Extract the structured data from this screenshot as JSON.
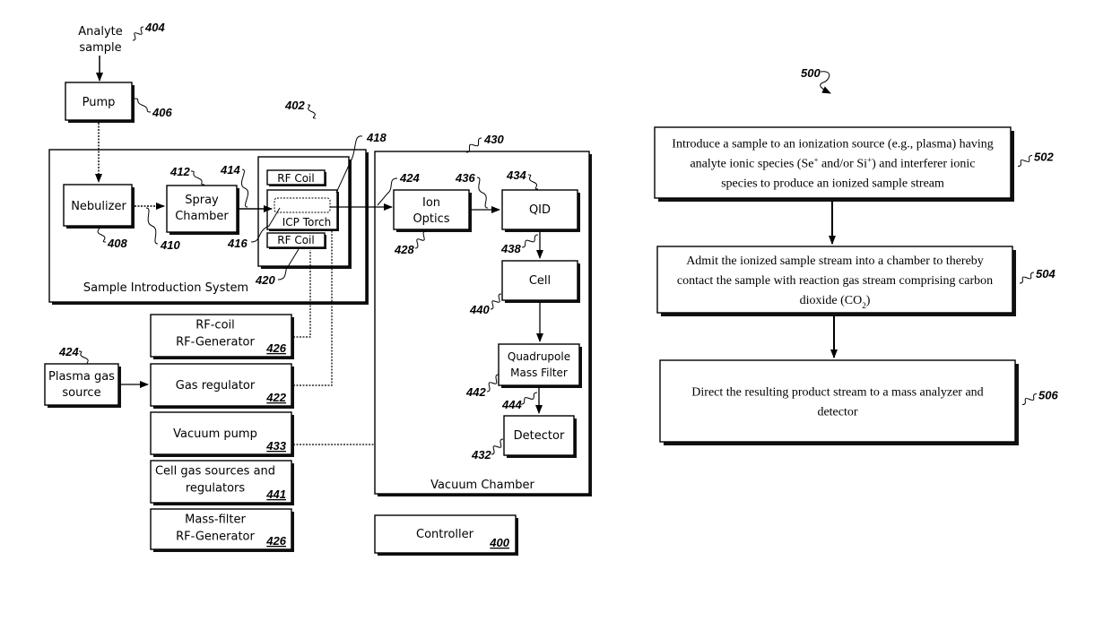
{
  "figure_left": {
    "ref": "402",
    "analyte_sample": {
      "lines": [
        "Analyte",
        "sample"
      ],
      "ref": "404"
    },
    "pump": {
      "label": "Pump",
      "ref": "406"
    },
    "sample_introduction_system": {
      "label": "Sample Introduction System",
      "nebulizer": {
        "label": "Nebulizer",
        "ref": "408"
      },
      "nebulizer_link_ref": "410",
      "spray_chamber": {
        "lines": [
          "Spray",
          "Chamber"
        ],
        "ref": "412"
      },
      "spray_link_ref": "414",
      "torch_assembly_ref": "418",
      "rf_coil_top": {
        "label": "RF Coil"
      },
      "icp_torch": {
        "label": "ICP Torch",
        "inner_ref": "416"
      },
      "rf_coil_bottom": {
        "label": "RF Coil",
        "ref": "420"
      }
    },
    "vacuum_chamber": {
      "label": "Vacuum Chamber",
      "ref": "430",
      "inlet_ref": "424",
      "ion_optics": {
        "lines": [
          "Ion",
          "Optics"
        ],
        "ref": "428"
      },
      "ion_link_ref": "436",
      "qid": {
        "label": "QID",
        "ref": "434"
      },
      "qid_link_ref": "438",
      "cell": {
        "label": "Cell",
        "ref": "440"
      },
      "quadrupole": {
        "lines": [
          "Quadrupole",
          "Mass Filter"
        ],
        "ref": "442"
      },
      "quad_link_ref": "444",
      "detector": {
        "label": "Detector",
        "ref": "432"
      }
    },
    "plasma_gas_source": {
      "lines": [
        "Plasma gas",
        "source"
      ],
      "ref": "424"
    },
    "support_units": [
      {
        "lines": [
          "RF-coil",
          "RF-Generator"
        ],
        "ref": "426"
      },
      {
        "lines": [
          "Gas regulator"
        ],
        "ref": "422"
      },
      {
        "lines": [
          "Vacuum pump"
        ],
        "ref": "433"
      },
      {
        "lines": [
          "Cell gas sources and",
          "regulators"
        ],
        "ref": "441"
      },
      {
        "lines": [
          "Mass-filter",
          "RF-Generator"
        ],
        "ref": "426"
      }
    ],
    "controller": {
      "label": "Controller",
      "ref": "400"
    }
  },
  "figure_right": {
    "ref": "500",
    "steps": [
      {
        "ref": "502",
        "lines": [
          [
            {
              "t": "Introduce a sample to an ionization source (e.g., plasma) having"
            }
          ],
          [
            {
              "t": "analyte ionic species (Se"
            },
            {
              "t": "+",
              "sup": true
            },
            {
              "t": " and/or Si"
            },
            {
              "t": "+",
              "sup": true
            },
            {
              "t": ") and interferer ionic"
            }
          ],
          [
            {
              "t": "species to produce an ionized sample stream"
            }
          ]
        ]
      },
      {
        "ref": "504",
        "lines": [
          [
            {
              "t": "Admit the ionized sample stream into a chamber to thereby"
            }
          ],
          [
            {
              "t": "contact the sample with reaction gas stream comprising carbon"
            }
          ],
          [
            {
              "t": "dioxide (CO"
            },
            {
              "t": "2",
              "sub": true
            },
            {
              "t": ")"
            }
          ]
        ]
      },
      {
        "ref": "506",
        "lines": [
          [
            {
              "t": "Direct the resulting product stream to a mass analyzer and"
            }
          ],
          [
            {
              "t": "detector"
            }
          ]
        ]
      }
    ]
  }
}
